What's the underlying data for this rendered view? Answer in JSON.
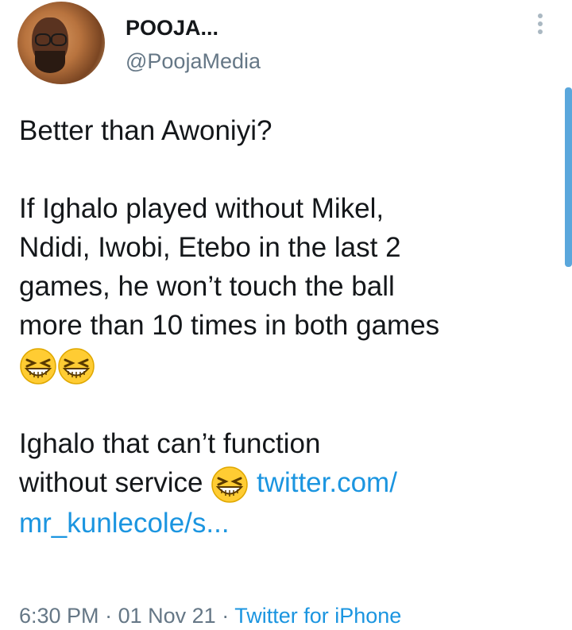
{
  "tweet": {
    "author_name": "POOJA...",
    "author_handle": "@PoojaMedia",
    "lines": [
      "Better than Awoniyi?",
      "",
      "If Ighalo played without Mikel,",
      "Ndidi, Iwobi, Etebo in the last 2",
      "games, he won’t touch the ball",
      "more than 10 times in both games",
      "",
      "",
      "Ighalo that can’t function"
    ],
    "last_line_text": "without service",
    "link_part1": "twitter.com/",
    "link_part2": "mr_kunlecole/s...",
    "emoji_name": "grinning-squinting-face-emoji",
    "emoji_count_row": 2,
    "time": "6:30 PM",
    "separator": "·",
    "date": "01 Nov 21",
    "source": "Twitter for iPhone"
  },
  "colors": {
    "link": "#1b95e0",
    "text": "#14171a",
    "muted": "#657786",
    "scrollbar": "#5aa7dc"
  }
}
